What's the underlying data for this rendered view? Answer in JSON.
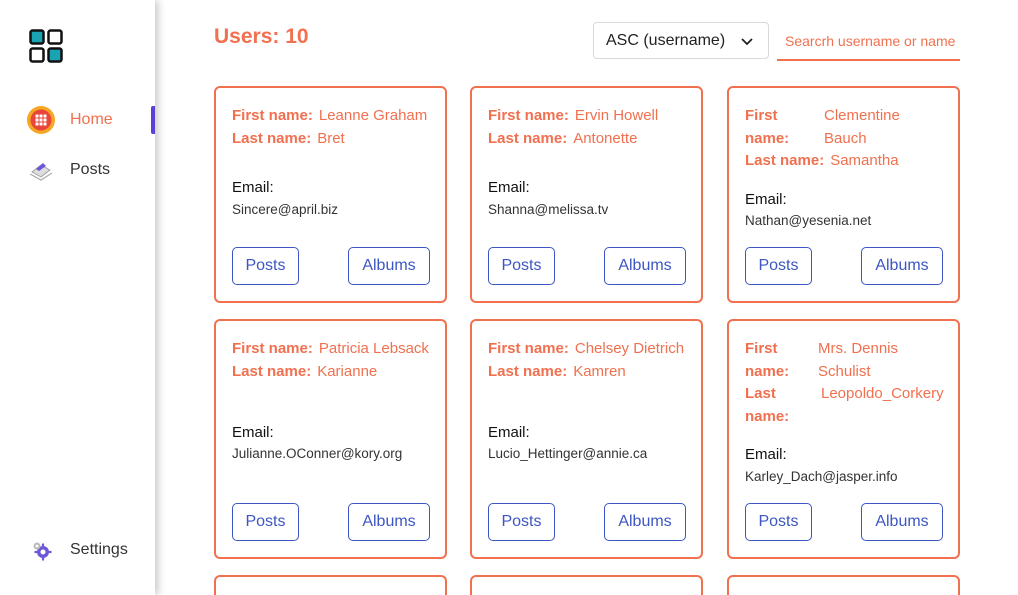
{
  "sidebar": {
    "logo": "grid-logo",
    "items": [
      {
        "label": "Home",
        "icon": "home-grid-icon",
        "active": true
      },
      {
        "label": "Posts",
        "icon": "laptop-icon",
        "active": false
      },
      {
        "label": "Settings",
        "icon": "settings-gear-icon",
        "active": false
      }
    ]
  },
  "header": {
    "users_count": "Users: 10",
    "sort_value": "ASC (username)",
    "search_placeholder": "Searcrh username or name"
  },
  "labels": {
    "first_name": "First name:",
    "last_name": "Last name:",
    "email": "Email:",
    "posts": "Posts",
    "albums": "Albums"
  },
  "users": [
    {
      "first": "Leanne Graham",
      "last": "Bret",
      "email": "Sincere@april.biz"
    },
    {
      "first": "Ervin Howell",
      "last": "Antonette",
      "email": "Shanna@melissa.tv"
    },
    {
      "first": "Clementine Bauch",
      "last": "Samantha",
      "email": "Nathan@yesenia.net"
    },
    {
      "first": "Patricia Lebsack",
      "last": "Karianne",
      "email": "Julianne.OConner@kory.org"
    },
    {
      "first": "Chelsey Dietrich",
      "last": "Kamren",
      "email": "Lucio_Hettinger@annie.ca"
    },
    {
      "first": "Mrs. Dennis Schulist",
      "last": "Leopoldo_Corkery",
      "email": "Karley_Dach@jasper.info"
    }
  ],
  "colors": {
    "accent": "#f0704f",
    "button": "#3d56c4",
    "indicator": "#5b3fd6"
  }
}
